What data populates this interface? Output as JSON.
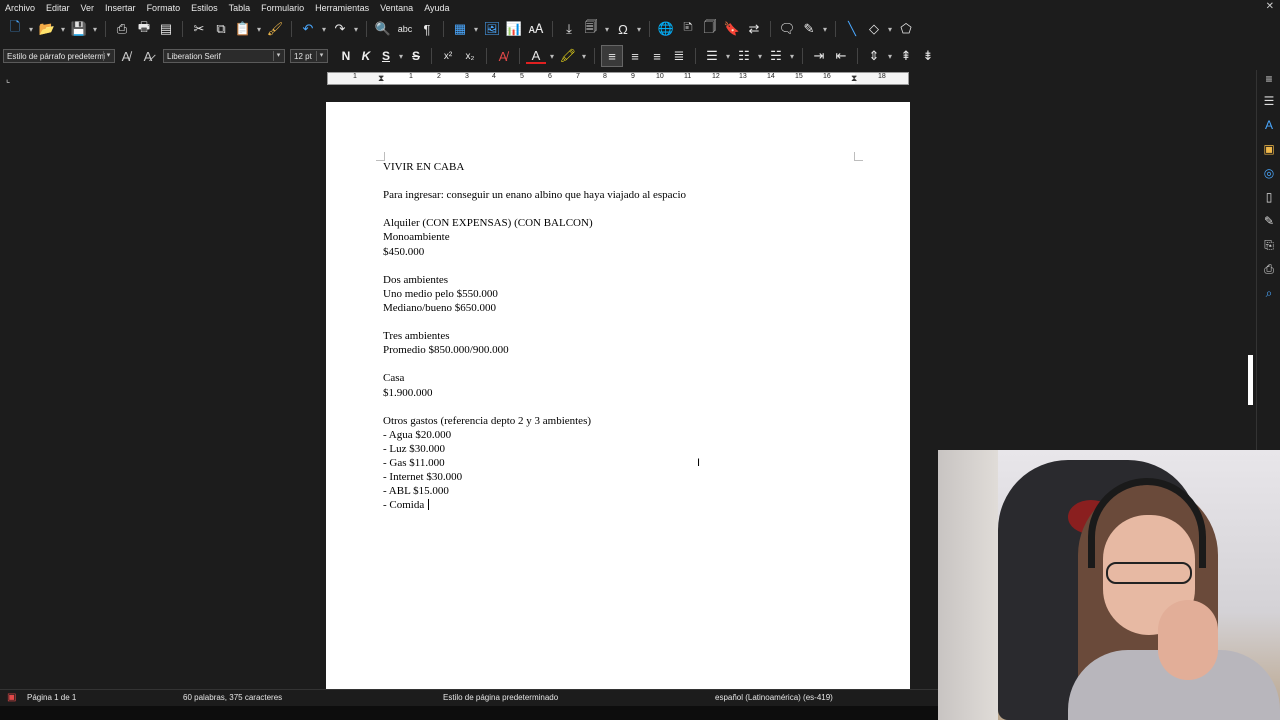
{
  "menubar": {
    "items": [
      "Archivo",
      "Editar",
      "Ver",
      "Insertar",
      "Formato",
      "Estilos",
      "Tabla",
      "Formulario",
      "Herramientas",
      "Ventana",
      "Ayuda"
    ],
    "close_glyph": "✕"
  },
  "toolbar": {
    "paragraph_style": "Estilo de párrafo predeterminado",
    "font_name": "Liberation Serif",
    "font_size": "12 pt",
    "bold": "N",
    "italic": "K",
    "underline": "S",
    "strikethrough": "S",
    "superscript": "x²",
    "subscript": "x₂"
  },
  "ruler": {
    "numbers": [
      "1",
      "1",
      "2",
      "3",
      "4",
      "5",
      "6",
      "7",
      "8",
      "9",
      "10",
      "11",
      "12",
      "13",
      "14",
      "15",
      "16",
      "17",
      "18"
    ]
  },
  "document": {
    "lines": [
      "VIVIR EN CABA",
      "",
      "Para ingresar: conseguir un enano albino que haya viajado al espacio",
      "",
      "Alquiler (CON EXPENSAS) (CON BALCON)",
      "Monoambiente",
      "$450.000",
      "",
      "Dos ambientes",
      "Uno medio pelo $550.000",
      "Mediano/bueno $650.000",
      "",
      "Tres ambientes",
      "Promedio $850.000/900.000",
      "",
      "Casa",
      "$1.900.000",
      "",
      "Otros gastos (referencia depto 2 y 3 ambientes)",
      "- Agua $20.000",
      "- Luz $30.000",
      "- Gas $11.000",
      "- Internet $30.000",
      "- ABL $15.000",
      "- Comida "
    ]
  },
  "statusbar": {
    "page": "Página 1 de 1",
    "words": "60 palabras, 375 caracteres",
    "page_style": "Estilo de página predeterminado",
    "language": "español (Latinoamérica) (es-419)"
  },
  "colors": {
    "chrome_bg": "#1c1c1c",
    "page_bg": "#ffffff",
    "accent_blue": "#4aa8ff"
  }
}
